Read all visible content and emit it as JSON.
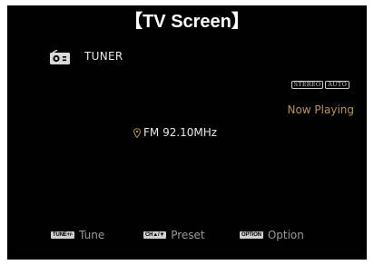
{
  "header": {
    "title": "【TV Screen】"
  },
  "screen": {
    "source_label": "TUNER",
    "source_icon": "radio-icon",
    "badges": [
      "STEREO",
      "AUTO"
    ],
    "status": "Now Playing",
    "station_icon": "location-pin-icon",
    "frequency": "FM 92.10MHz",
    "accent_color": "#b8955a"
  },
  "footer": {
    "hints": [
      {
        "key": "TUNE+/-",
        "label": "Tune"
      },
      {
        "key": "CH▲/▼",
        "label": "Preset"
      },
      {
        "key": "OPTION",
        "label": "Option"
      }
    ]
  }
}
